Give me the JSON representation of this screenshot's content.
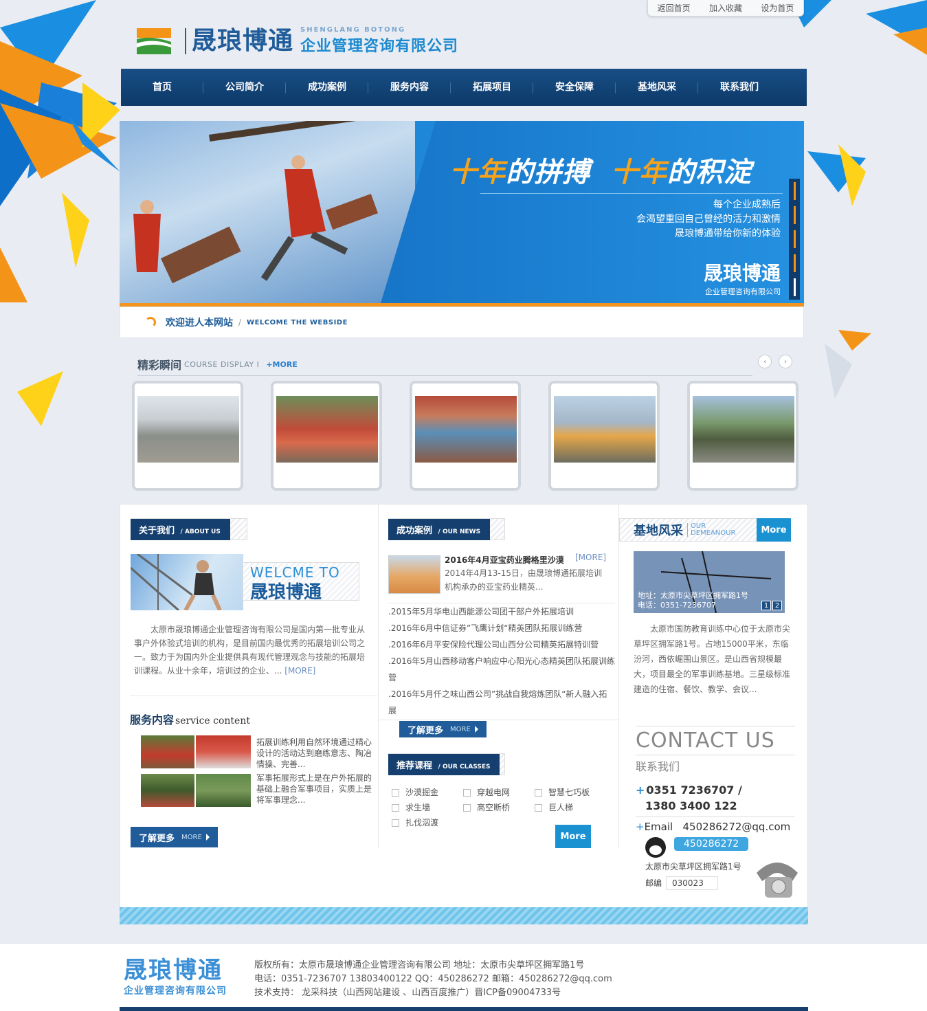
{
  "top_links": [
    "返回首页",
    "加入收藏",
    "设为首页"
  ],
  "logo": {
    "name": "晟琅博通",
    "en": "SHENGLANG BOTONG",
    "sub": "企业管理咨询有限公司"
  },
  "nav": [
    "首页",
    "公司简介",
    "成功案例",
    "服务内容",
    "拓展项目",
    "安全保障",
    "基地风采",
    "联系我们"
  ],
  "banner": {
    "slogan_a": "十年",
    "slogan_b": "的拼搏",
    "slogan_c": "十年",
    "slogan_d": "的积淀",
    "line1": "每个企业成熟后",
    "line2": "会渴望重回自己曾经的活力和激情",
    "line3": "晟琅博通带给你新的体验",
    "brand": "晟琅博通",
    "brand_sub": "企业管理咨询有限公司"
  },
  "welcome": {
    "cn": "欢迎进人本网站",
    "sep": "/",
    "en": "WELCOME THE WEBSIDE"
  },
  "gallery": {
    "cn": "精彩瞬间",
    "en": "COURSE DISPLAY",
    "sep": "I",
    "more": "+MORE",
    "prev": "‹",
    "next": "›"
  },
  "about": {
    "tag_cn": "关于我们",
    "tag_en": "/ ABOUT US",
    "welcome_en": "WELCME  TO",
    "welcome_cn": "晟琅博通",
    "text": "太原市晟琅博通企业管理咨询有限公司是国内第一批专业从事户外体验式培训的机构，是目前国内最优秀的拓展培训公司之一。致力于为国内外企业提供具有现代管理观念与技能的拓展培训课程。从业十余年，培训过的企业、... ",
    "more": "[MORE]"
  },
  "service": {
    "title_cn": "服务内容",
    "title_en": "service content",
    "text1": "拓展训练利用自然环境通过精心设计的活动达到磨练意志、陶冶情操、完善...",
    "text2": "军事拓展形式上是在户外拓展的基础上融合军事项目，实质上是将军事理念...",
    "btn_cn": "了解更多",
    "btn_en": "MORE"
  },
  "news": {
    "tag_cn": "成功案例",
    "tag_en": "/ OUR NEWS",
    "feature_title": "2016年4月亚宝药业腾格里沙漠",
    "feature_more": "[MORE]",
    "feature_desc": "2014年4月13-15日，由晟琅博通拓展培训机构承办的亚宝药业精英...",
    "items": [
      ".2015年5月华电山西能源公司团干部户外拓展培训",
      ".2016年6月中信证券”飞鹰计划“精英团队拓展训练营",
      ".2016年6月平安保险代理公司山西分公司精英拓展特训营",
      ".2016年5月山西移动客户响应中心阳光心态精英团队拓展训练营",
      ".2016年5月仟之味山西公司”挑战自我熔炼团队“新人融入拓展"
    ],
    "btn_cn": "了解更多",
    "btn_en": "MORE"
  },
  "classes": {
    "tag_cn": "推荐课程",
    "tag_en": "/ OUR CLASSES",
    "items": [
      "沙漠掘金",
      "穿越电网",
      "智慧七巧板",
      "求生墙",
      "高空断桥",
      "巨人梯",
      "扎伐泅渡"
    ],
    "more": "More"
  },
  "base": {
    "cn": "基地风采",
    "en1": "OUR",
    "en2": "DEMEANOUR",
    "more": "More",
    "addr": "地址：太原市尖草坪区拥军路1号",
    "tel": "电话：0351-7236707",
    "n1": "1",
    "n2": "2",
    "text": "太原市国防教育训练中心位于太原市尖草坪区拥军路1号。占地15000平米，东临汾河，西依崛围山景区。是山西省规模最大，项目最全的军事训练基地。三星级标准建造的住宿、餐饮、教学、会议..."
  },
  "contact": {
    "title_en": "CONTACT US",
    "title_cn": "联系我们",
    "phone1": "0351 7236707 /",
    "phone2": "1380 3400 122",
    "email_label": "Email",
    "email": "450286272@qq.com",
    "qq": "450286272",
    "addr": "太原市尖草坪区拥军路1号",
    "postcode_label": "邮编",
    "postcode": "030023"
  },
  "footer": {
    "logo_a": "晟琅博通",
    "logo_b": "企业管理咨询有限公司",
    "line1": "版权所有：太原市晟琅博通企业管理咨询有限公司    地址：太原市尖草坪区拥军路1号",
    "line2": "电话：0351-7236707    13803400122    QQ：450286272    邮箱：450286272@qq.com",
    "line3": "技术支持：    龙采科技（山西网站建设 、山西百度推广）晋ICP备09004733号"
  }
}
